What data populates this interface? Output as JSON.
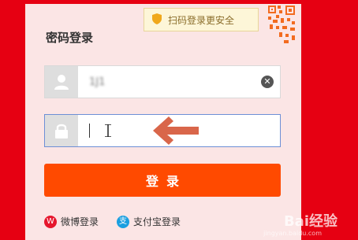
{
  "colors": {
    "background": "#e60012",
    "card": "#fbe5e5",
    "button": "#ff4a00",
    "arrow": "#d9664a",
    "focus_border": "#6d8fd6"
  },
  "qr_tip": {
    "icon": "shield-icon",
    "text": "扫码登录更安全"
  },
  "form": {
    "title": "密码登录",
    "username": {
      "icon": "user-icon",
      "value": "1J1",
      "clear_icon": "clear-icon"
    },
    "password": {
      "icon": "lock-icon",
      "value": ""
    },
    "submit_label": "登录"
  },
  "alt_login": [
    {
      "icon": "weibo-icon",
      "label": "微博登录"
    },
    {
      "icon": "alipay-icon",
      "label": "支付宝登录"
    }
  ],
  "watermark": {
    "text": "Bai经验",
    "sub": "jingyan.baidu.com"
  }
}
